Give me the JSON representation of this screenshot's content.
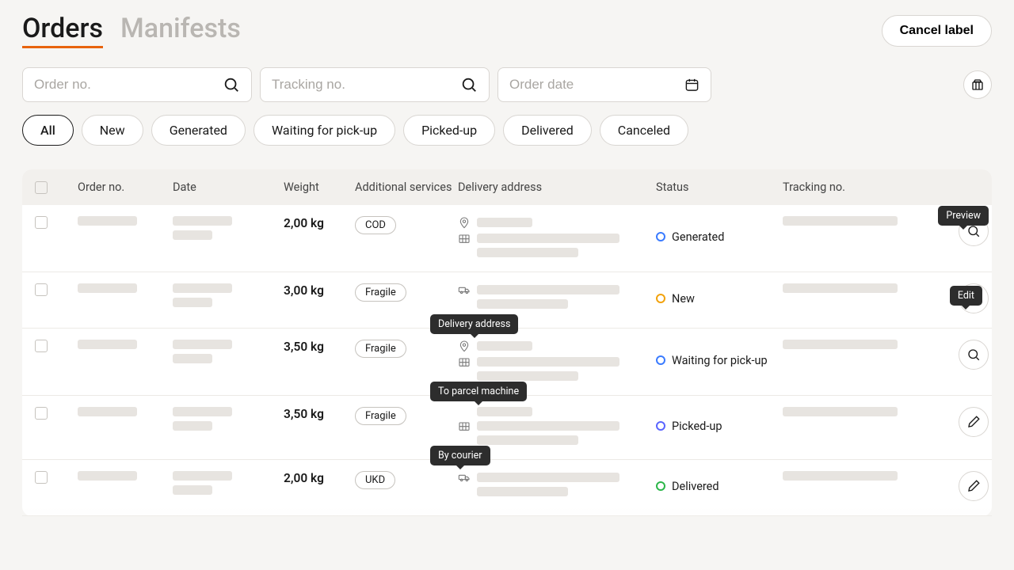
{
  "header": {
    "tabs": [
      "Orders",
      "Manifests"
    ],
    "active_tab": 0,
    "cancel_label": "Cancel label"
  },
  "search": {
    "order_placeholder": "Order no.",
    "tracking_placeholder": "Tracking no.",
    "date_placeholder": "Order date"
  },
  "filters": [
    "All",
    "New",
    "Generated",
    "Waiting for pick-up",
    "Picked-up",
    "Delivered",
    "Canceled"
  ],
  "active_filter": 0,
  "columns": {
    "order_no": "Order no.",
    "date": "Date",
    "weight": "Weight",
    "services": "Additional services",
    "address": "Delivery address",
    "status": "Status",
    "tracking": "Tracking no."
  },
  "tooltips": {
    "preview": "Preview",
    "edit": "Edit",
    "delivery_address": "Delivery address",
    "to_parcel_machine": "To parcel machine",
    "by_courier": "By courier"
  },
  "rows": [
    {
      "weight": "2,00 kg",
      "service": "COD",
      "status_label": "Generated",
      "status_color": "dot-blue",
      "action": "preview",
      "addr_kind": "pin_parcel"
    },
    {
      "weight": "3,00 kg",
      "service": "Fragile",
      "status_label": "New",
      "status_color": "dot-yellow",
      "action": "edit",
      "addr_kind": "courier"
    },
    {
      "weight": "3,50 kg",
      "service": "Fragile",
      "status_label": "Waiting for pick-up",
      "status_color": "dot-blue",
      "action": "preview",
      "addr_kind": "pin_parcel",
      "tooltip_over": "delivery_address"
    },
    {
      "weight": "3,50 kg",
      "service": "Fragile",
      "status_label": "Picked-up",
      "status_color": "dot-purple",
      "action": "edit",
      "addr_kind": "parcel_only",
      "tooltip_over": "to_parcel_machine"
    },
    {
      "weight": "2,00 kg",
      "service": "UKD",
      "status_label": "Delivered",
      "status_color": "dot-green",
      "action": "edit",
      "addr_kind": "courier",
      "tooltip_over": "by_courier"
    }
  ]
}
